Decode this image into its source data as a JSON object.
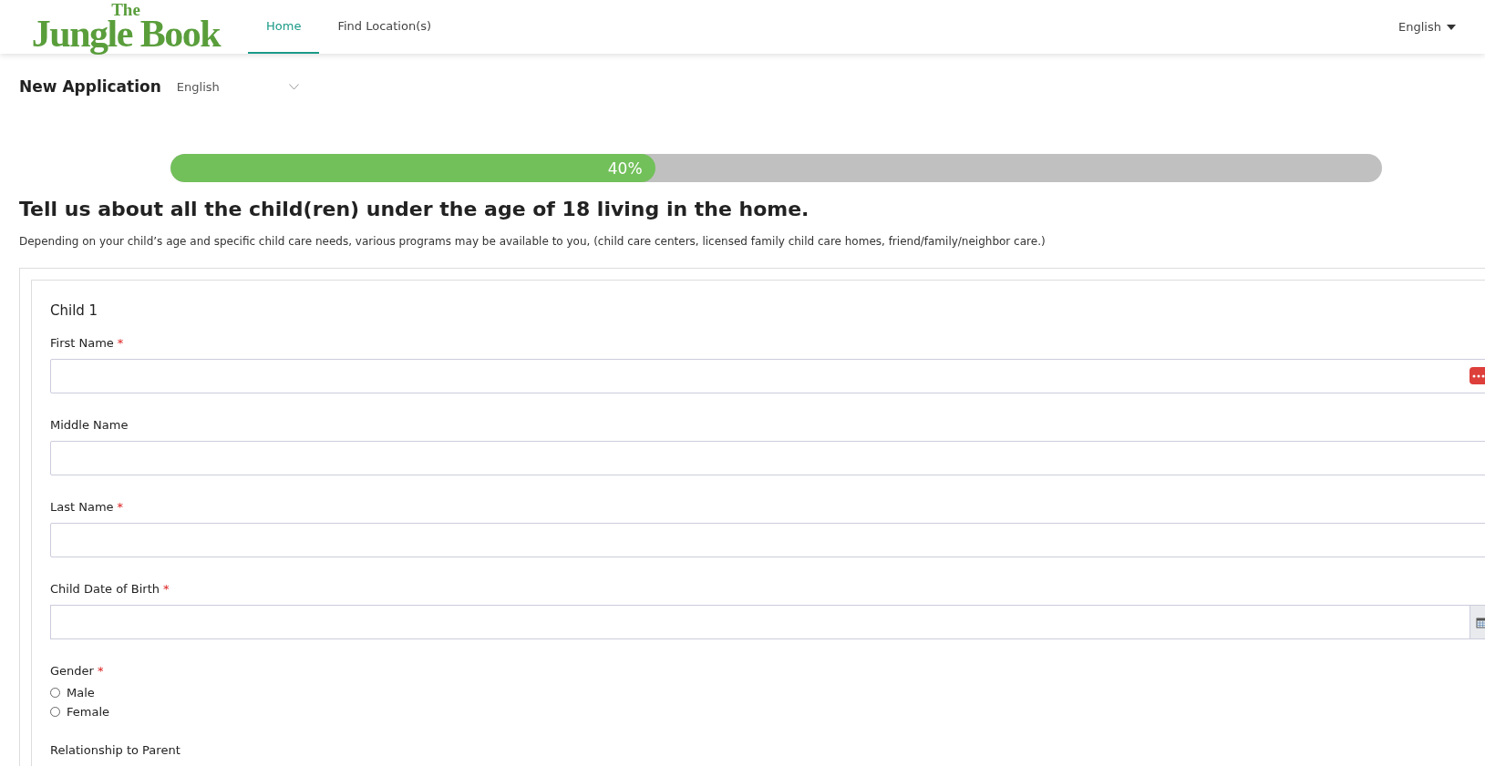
{
  "header": {
    "logo": {
      "top": "The",
      "main": "Jungle Book"
    },
    "nav": [
      {
        "label": "Home",
        "selected": true
      },
      {
        "label": "Find Location(s)",
        "selected": false
      }
    ],
    "language": "English"
  },
  "page": {
    "title": "New Application",
    "language_select": "English"
  },
  "progress": {
    "level": 0.4,
    "reading": "40%"
  },
  "heading": "Tell us about all the child(ren) under the age of 18 living in the home.",
  "description": "Depending on your child’s age and specific child care needs, various programs may be available to you, (child care centers, licensed family child care homes, friend/family/neighbor care.)",
  "child": {
    "title": "Child 1",
    "fields": [
      {
        "kind": "text",
        "label": "First Name",
        "required_mark": "*",
        "autofill_badge": true
      },
      {
        "kind": "text",
        "label": "Middle Name"
      },
      {
        "kind": "text",
        "label": "Last Name",
        "required_mark": "*"
      },
      {
        "kind": "date",
        "label": "Child Date of Birth",
        "required_mark": "*"
      },
      {
        "kind": "radio",
        "label": "Gender",
        "required_mark": "*",
        "options": [
          {
            "label": "Male",
            "selected": false
          },
          {
            "label": "Female",
            "selected": false
          }
        ]
      },
      {
        "kind": "heading",
        "label": "Relationship to Parent"
      }
    ]
  }
}
